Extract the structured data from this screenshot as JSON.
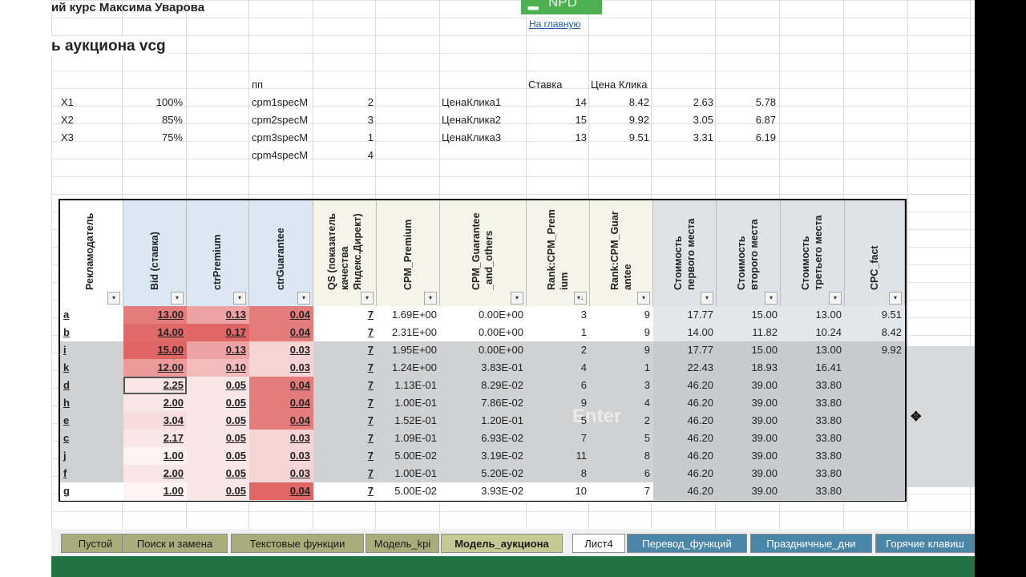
{
  "header": {
    "course_title": "ий курс Максима Уварова",
    "sheet_heading": "ь аукциона vcg",
    "logo_text": "NPD",
    "home_link": "На главную"
  },
  "colors": {
    "red_strong": "#e06666",
    "red_light": "#f2b8b8",
    "header_blue": "#dbe8f4",
    "header_cream": "#f4f4e8",
    "grey_band": "#c9cbce",
    "tab_green": "#a5ab7a",
    "tab_blue": "#4f86a8",
    "status_green": "#217346"
  },
  "top_block": {
    "pp_label": "пп",
    "stavka_label": "Ставка",
    "cena_label": "Цена Клика",
    "rows": [
      {
        "x": "X1",
        "pct": "100%",
        "spec": "cpm1specM",
        "n": "2",
        "cena": "ЦенаКлика1",
        "stavka": "14",
        "v1": "8.42",
        "v2": "2.63",
        "v3": "5.78"
      },
      {
        "x": "X2",
        "pct": "85%",
        "spec": "cpm2specM",
        "n": "3",
        "cena": "ЦенаКлика2",
        "stavka": "15",
        "v1": "9.92",
        "v2": "3.05",
        "v3": "6.87"
      },
      {
        "x": "X3",
        "pct": "75%",
        "spec": "cpm3specM",
        "n": "1",
        "cena": "ЦенаКлика3",
        "stavka": "13",
        "v1": "9.51",
        "v2": "3.31",
        "v3": "6.19"
      },
      {
        "x": "",
        "pct": "",
        "spec": "cpm4specM",
        "n": "4",
        "cena": "",
        "stavka": "",
        "v1": "",
        "v2": "",
        "v3": ""
      }
    ]
  },
  "table": {
    "headers": [
      {
        "line1": "Рекламодатель",
        "line2": ""
      },
      {
        "line1": "Bid (ставка)",
        "line2": ""
      },
      {
        "line1": "ctrPremium",
        "line2": ""
      },
      {
        "line1": "ctrGuarantee",
        "line2": ""
      },
      {
        "line1": "QS (показатель",
        "line2": "качества",
        "line3": "Яндекс.Директ)"
      },
      {
        "line1": "CPM_Premium",
        "line2": ""
      },
      {
        "line1": "CPM_Guarantee",
        "line2": "_and_others"
      },
      {
        "line1": "Rank:CPM_Prem",
        "line2": "ium"
      },
      {
        "line1": "Rank:CPM_Guar",
        "line2": "antee"
      },
      {
        "line1": "Стоимость",
        "line2": "первого места"
      },
      {
        "line1": "Стоимость",
        "line2": "второго места"
      },
      {
        "line1": "Стоимость",
        "line2": "третьего места"
      },
      {
        "line1": "CPC_fact",
        "line2": ""
      }
    ],
    "rows": [
      {
        "adv": "a",
        "bid": "13.00",
        "ctrp": "0.13",
        "ctrg": "0.04",
        "qs": "7",
        "cpmp": "1.69E+00",
        "cpmg": "0.00E+00",
        "rp": "3",
        "rg": "9",
        "s1": "17.77",
        "s2": "15.00",
        "s3": "13.00",
        "cpc": "9.51"
      },
      {
        "adv": "b",
        "bid": "14.00",
        "ctrp": "0.17",
        "ctrg": "0.04",
        "qs": "7",
        "cpmp": "2.31E+00",
        "cpmg": "0.00E+00",
        "rp": "1",
        "rg": "9",
        "s1": "14.00",
        "s2": "11.82",
        "s3": "10.24",
        "cpc": "8.42"
      },
      {
        "adv": "i",
        "bid": "15.00",
        "ctrp": "0.13",
        "ctrg": "0.03",
        "qs": "7",
        "cpmp": "1.95E+00",
        "cpmg": "0.00E+00",
        "rp": "2",
        "rg": "9",
        "s1": "17.77",
        "s2": "15.00",
        "s3": "13.00",
        "cpc": "9.92"
      },
      {
        "adv": "k",
        "bid": "12.00",
        "ctrp": "0.10",
        "ctrg": "0.03",
        "qs": "7",
        "cpmp": "1.24E+00",
        "cpmg": "3.83E-01",
        "rp": "4",
        "rg": "1",
        "s1": "22.43",
        "s2": "18.93",
        "s3": "16.41",
        "cpc": ""
      },
      {
        "adv": "d",
        "bid": "2.25",
        "ctrp": "0.05",
        "ctrg": "0.04",
        "qs": "7",
        "cpmp": "1.13E-01",
        "cpmg": "8.29E-02",
        "rp": "6",
        "rg": "3",
        "s1": "46.20",
        "s2": "39.00",
        "s3": "33.80",
        "cpc": ""
      },
      {
        "adv": "h",
        "bid": "2.00",
        "ctrp": "0.05",
        "ctrg": "0.04",
        "qs": "7",
        "cpmp": "1.00E-01",
        "cpmg": "7.86E-02",
        "rp": "9",
        "rg": "4",
        "s1": "46.20",
        "s2": "39.00",
        "s3": "33.80",
        "cpc": ""
      },
      {
        "adv": "e",
        "bid": "3.04",
        "ctrp": "0.05",
        "ctrg": "0.04",
        "qs": "7",
        "cpmp": "1.52E-01",
        "cpmg": "1.20E-01",
        "rp": "5",
        "rg": "2",
        "s1": "46.20",
        "s2": "39.00",
        "s3": "33.80",
        "cpc": ""
      },
      {
        "adv": "c",
        "bid": "2.17",
        "ctrp": "0.05",
        "ctrg": "0.03",
        "qs": "7",
        "cpmp": "1.09E-01",
        "cpmg": "6.93E-02",
        "rp": "7",
        "rg": "5",
        "s1": "46.20",
        "s2": "39.00",
        "s3": "33.80",
        "cpc": ""
      },
      {
        "adv": "j",
        "bid": "1.00",
        "ctrp": "0.05",
        "ctrg": "0.03",
        "qs": "7",
        "cpmp": "5.00E-02",
        "cpmg": "3.19E-02",
        "rp": "11",
        "rg": "8",
        "s1": "46.20",
        "s2": "39.00",
        "s3": "33.80",
        "cpc": ""
      },
      {
        "adv": "f",
        "bid": "2.00",
        "ctrp": "0.05",
        "ctrg": "0.03",
        "qs": "7",
        "cpmp": "1.00E-01",
        "cpmg": "5.20E-02",
        "rp": "8",
        "rg": "6",
        "s1": "46.20",
        "s2": "39.00",
        "s3": "33.80",
        "cpc": ""
      },
      {
        "adv": "g",
        "bid": "1.00",
        "ctrp": "0.05",
        "ctrg": "0.04",
        "qs": "7",
        "cpmp": "5.00E-02",
        "cpmg": "3.93E-02",
        "rp": "10",
        "rg": "7",
        "s1": "46.20",
        "s2": "39.00",
        "s3": "33.80",
        "cpc": ""
      }
    ]
  },
  "watermark": "Enter",
  "sheet_tabs": [
    {
      "label": "Пустой",
      "style": "green"
    },
    {
      "label": "Поиск и замена",
      "style": "green"
    },
    {
      "label": "Текстовые функции",
      "style": "green"
    },
    {
      "label": "Модель_kpi",
      "style": "green"
    },
    {
      "label": "Модель_аукциона",
      "style": "green-active"
    },
    {
      "label": "Лист4",
      "style": "white"
    },
    {
      "label": "Перевод_функций",
      "style": "blue"
    },
    {
      "label": "Праздничные_дни",
      "style": "blue"
    },
    {
      "label": "Горячие клавиш",
      "style": "blue"
    }
  ]
}
